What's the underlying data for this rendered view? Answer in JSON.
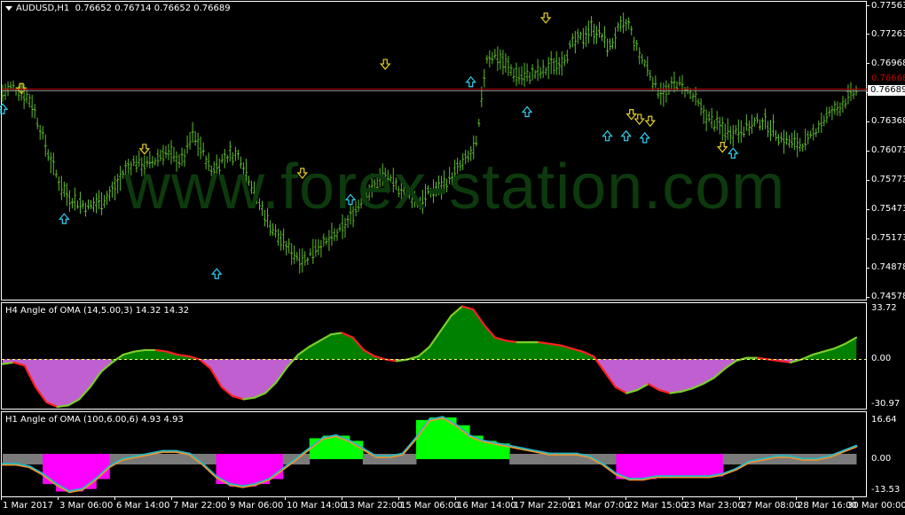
{
  "header": {
    "symbol_title": "AUDUSD,H1",
    "ohlc": "0.76652 0.76714 0.76652 0.76689"
  },
  "watermark": "www.forex-station.com",
  "price_axis": {
    "ticks": [
      "0.77563",
      "0.77263",
      "0.76968",
      "0.76668",
      "0.76368",
      "0.76073",
      "0.75773",
      "0.75473",
      "0.75173",
      "0.74878",
      "0.74578"
    ],
    "current_price": "0.76689",
    "current_price_box_color": "#ffffff",
    "ask_line_color": "#c00000"
  },
  "indicator1": {
    "title": "H4 Angle of OMA (14,5.00,3) 14.32 14.32",
    "ticks": [
      "33.72",
      "0.00",
      "-30.97"
    ],
    "colors": {
      "up": "#008000",
      "down": "#c060d0",
      "line_up": "#ff2020",
      "line_down": "#7ccd2a"
    }
  },
  "indicator2": {
    "title": "H1 Angle of OMA (100,6.00,6) 4.93 4.93",
    "ticks": [
      "16.64",
      "0.00",
      "-13.53"
    ],
    "colors": {
      "strong_up": "#00ff00",
      "strong_down": "#ff00ff",
      "neutral": "#7a7a7a",
      "line_a": "#ff9020",
      "line_b": "#20b8c8"
    }
  },
  "time_axis": [
    "1 Mar 2017",
    "3 Mar 06:00",
    "6 Mar 14:00",
    "7 Mar 22:00",
    "9 Mar 06:00",
    "10 Mar 14:00",
    "13 Mar 22:00",
    "15 Mar 06:00",
    "16 Mar 14:00",
    "17 Mar 22:00",
    "21 Mar 07:00",
    "22 Mar 15:00",
    "23 Mar 23:00",
    "27 Mar 08:00",
    "28 Mar 16:00",
    "30 Mar 00:00"
  ],
  "chart_data": {
    "type": "line",
    "title": "AUDUSD,H1",
    "ylim": [
      0.7455,
      0.7762
    ],
    "price_path": [
      0.7668,
      0.7675,
      0.767,
      0.766,
      0.763,
      0.76,
      0.7575,
      0.756,
      0.7555,
      0.755,
      0.7555,
      0.756,
      0.7572,
      0.759,
      0.7598,
      0.7593,
      0.7598,
      0.7608,
      0.7602,
      0.7598,
      0.7625,
      0.761,
      0.7588,
      0.7598,
      0.7605,
      0.7603,
      0.758,
      0.7555,
      0.7535,
      0.752,
      0.7508,
      0.75,
      0.7495,
      0.751,
      0.7512,
      0.752,
      0.7528,
      0.7545,
      0.756,
      0.757,
      0.7582,
      0.7575,
      0.7568,
      0.756,
      0.7555,
      0.7565,
      0.757,
      0.7578,
      0.759,
      0.76,
      0.7615,
      0.7705,
      0.7708,
      0.7698,
      0.7688,
      0.7686,
      0.7688,
      0.769,
      0.7698,
      0.7702,
      0.7718,
      0.7725,
      0.7735,
      0.773,
      0.7715,
      0.7735,
      0.774,
      0.771,
      0.7695,
      0.7672,
      0.7668,
      0.768,
      0.7672,
      0.7662,
      0.7645,
      0.7638,
      0.763,
      0.7628,
      0.7632,
      0.7635,
      0.764,
      0.7633,
      0.7622,
      0.7618,
      0.7615,
      0.7618,
      0.7635,
      0.7645,
      0.7652,
      0.7662,
      0.767
    ],
    "arrows": {
      "up": [
        [
          0,
          0.7657
        ],
        [
          23,
          0.7543
        ],
        [
          80,
          0.7486
        ],
        [
          130,
          0.7563
        ],
        [
          175,
          0.7685
        ],
        [
          196,
          0.7654
        ],
        [
          226,
          0.7629
        ],
        [
          233,
          0.7629
        ],
        [
          240,
          0.7627
        ],
        [
          273,
          0.7611
        ]
      ],
      "down": [
        [
          7,
          0.7668
        ],
        [
          53,
          0.7605
        ],
        [
          112,
          0.758
        ],
        [
          143,
          0.7693
        ],
        [
          203,
          0.7741
        ],
        [
          235,
          0.7641
        ],
        [
          238,
          0.7636
        ],
        [
          242,
          0.7634
        ],
        [
          269,
          0.7607
        ]
      ]
    }
  }
}
